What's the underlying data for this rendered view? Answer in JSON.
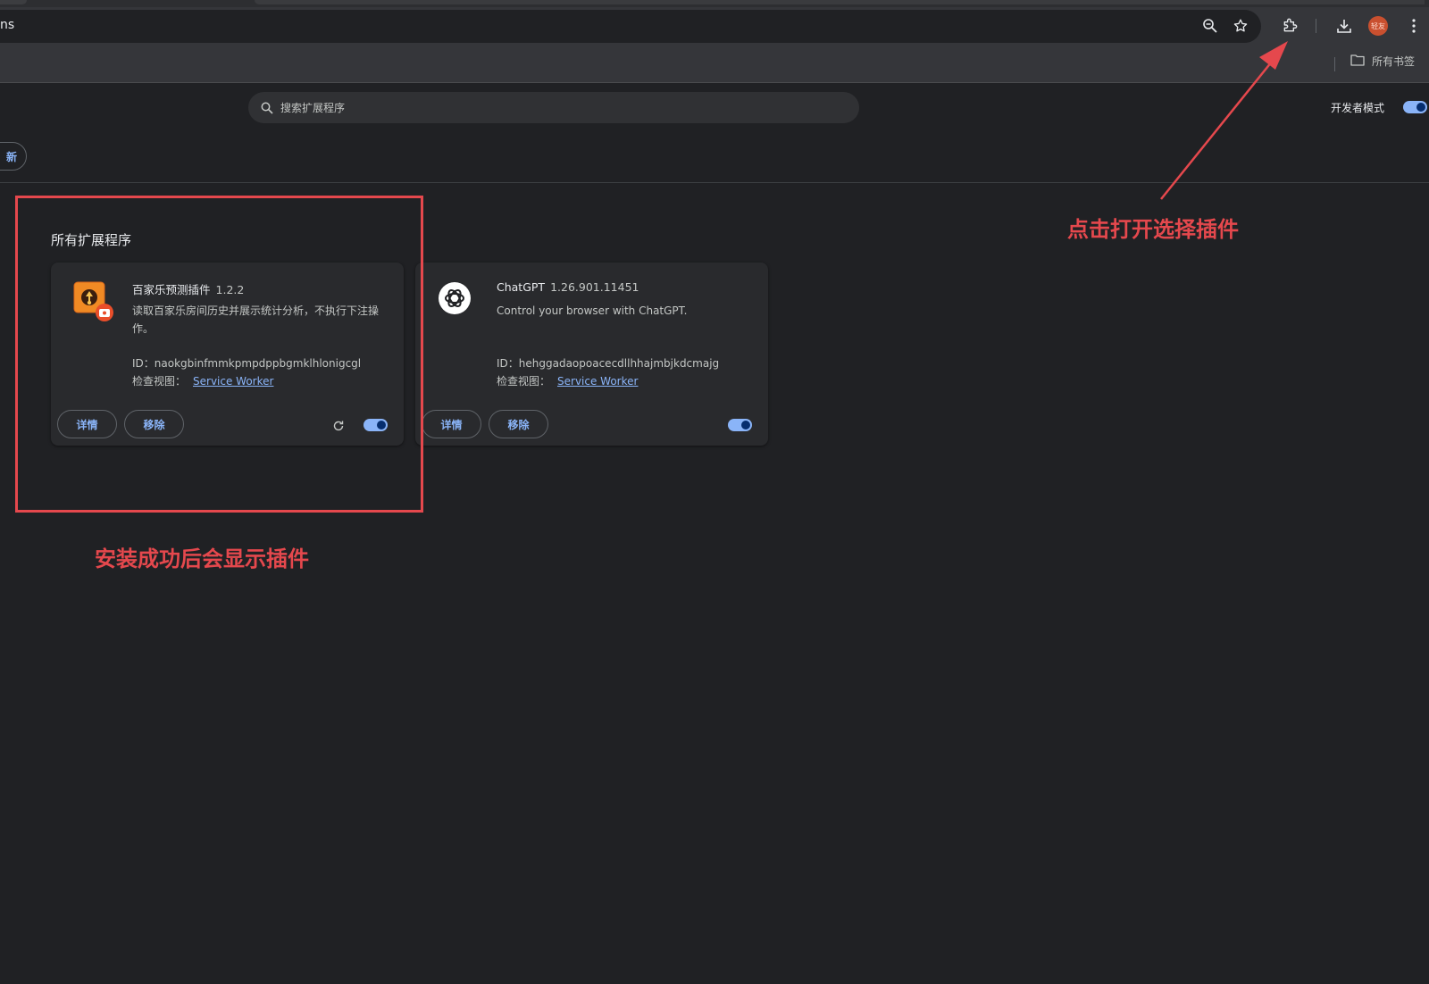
{
  "browser": {
    "omnibox_text": "ns",
    "profile_avatar_text": "轻友",
    "all_bookmarks_label": "所有书签"
  },
  "page": {
    "search_placeholder": "搜索扩展程序",
    "dev_mode_label": "开发者模式",
    "dev_mode_on": true,
    "update_button_label": "新",
    "section_title": "所有扩展程序"
  },
  "extensions": [
    {
      "name": "百家乐预测插件",
      "version": "1.2.2",
      "description": "读取百家乐房间历史并展示统计分析，不执行下注操作。",
      "id_label": "ID：",
      "id": "naokgbinfmmkpmpdppbgmklhlonigcgl",
      "inspect_label": "检查视图：",
      "inspect_link": "Service Worker",
      "details_label": "详情",
      "remove_label": "移除",
      "enabled": true,
      "icon": "baccarat-extension-icon"
    },
    {
      "name": "ChatGPT",
      "version": "1.26.901.11451",
      "description": "Control your browser with ChatGPT.",
      "id_label": "ID：",
      "id": "hehggadaopoacecdllhhajmbjkdcmajg",
      "inspect_label": "检查视图：",
      "inspect_link": "Service Worker",
      "details_label": "详情",
      "remove_label": "移除",
      "enabled": true,
      "icon": "openai-logo-icon"
    }
  ],
  "annotations": {
    "puzzle_hint": "点击打开选择插件",
    "installed_hint": "安装成功后会显示插件",
    "color": "#e5484d"
  },
  "colors": {
    "background": "#202124",
    "card": "#292a2d",
    "accent": "#8ab4f8"
  }
}
